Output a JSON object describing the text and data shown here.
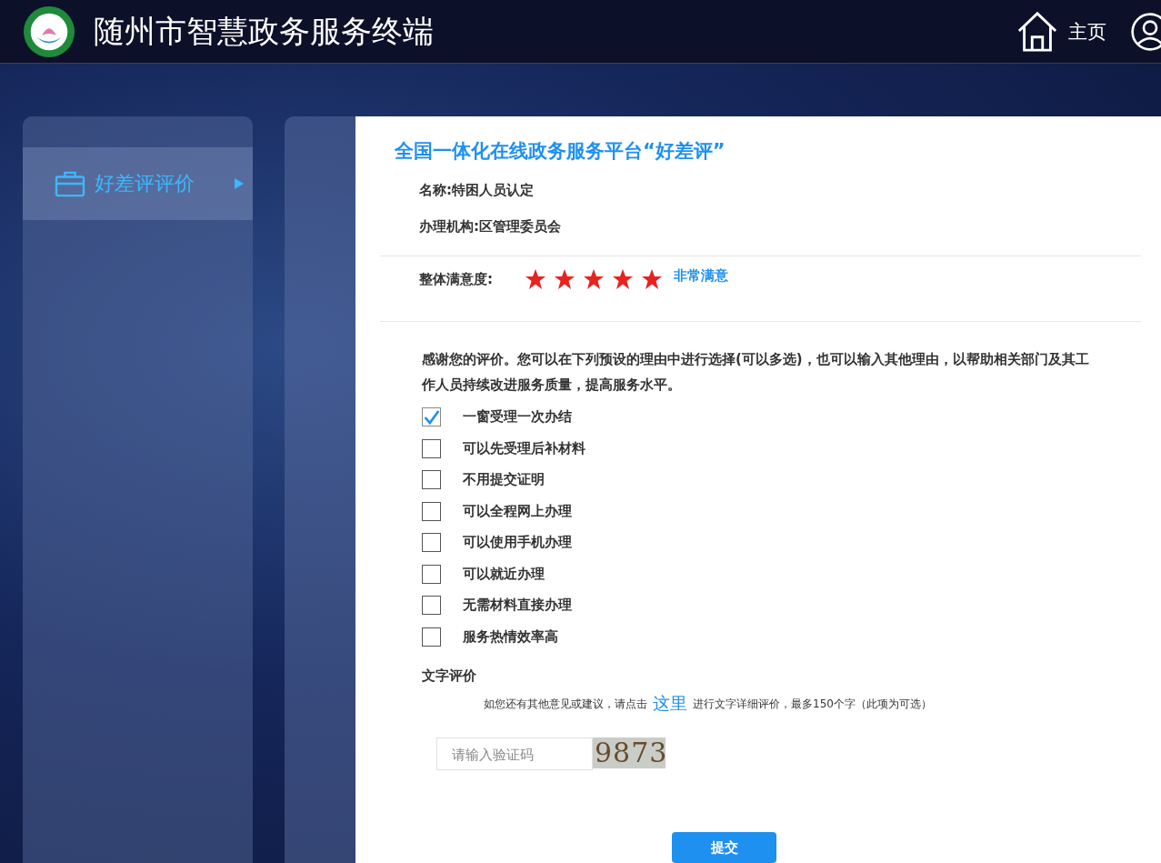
{
  "header": {
    "title": "随州市智慧政务服务终端",
    "home_label": "主页"
  },
  "sidebar": {
    "items": [
      {
        "label": "好差评评价",
        "selected": true
      }
    ]
  },
  "form": {
    "title": "全国一体化在线政务服务平台“好差评”",
    "name": "名称:特困人员认定",
    "org": "办理机构:区管理委员会",
    "satisfaction": {
      "label": "整体满意度:",
      "stars": 5,
      "text": "非常满意"
    },
    "intro": "感谢您的评价。您可以在下列预设的理由中进行选择(可以多选)，也可以输入其他理由，以帮助相关部门及其工作人员持续改进服务质量，提高服务水平。",
    "reasons": [
      {
        "label": "一窗受理一次办结",
        "checked": true
      },
      {
        "label": "可以先受理后补材料",
        "checked": false
      },
      {
        "label": "不用提交证明",
        "checked": false
      },
      {
        "label": "可以全程网上办理",
        "checked": false
      },
      {
        "label": "可以使用手机办理",
        "checked": false
      },
      {
        "label": "可以就近办理",
        "checked": false
      },
      {
        "label": "无需材料直接办理",
        "checked": false
      },
      {
        "label": "服务热情效率高",
        "checked": false
      }
    ],
    "text_review": {
      "heading": "文字评价",
      "hint_before": "如您还有其他意见或建议，请点击",
      "link": "这里",
      "hint_after": "进行文字详细评价，最多150个字（此项为可选）"
    },
    "captcha": {
      "placeholder": "请输入验证码",
      "code": "9873"
    },
    "submit": "提交"
  }
}
